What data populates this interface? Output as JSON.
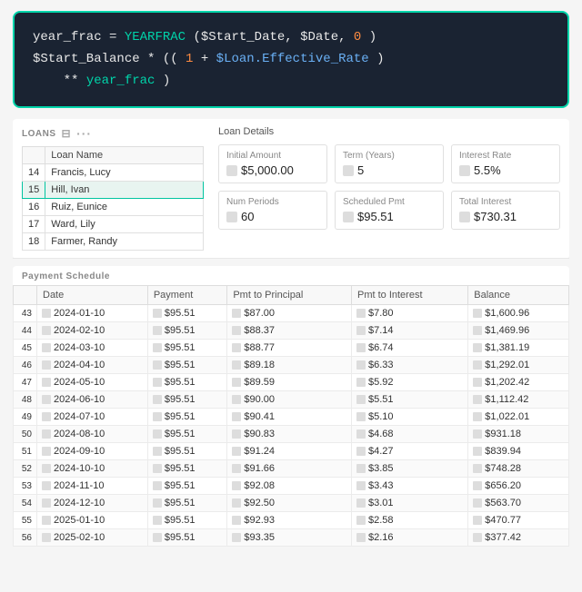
{
  "code": {
    "line1_parts": [
      {
        "text": "year_frac",
        "color": "white"
      },
      {
        "text": " = ",
        "color": "white"
      },
      {
        "text": "YEARFRAC",
        "color": "cyan"
      },
      {
        "text": "($Start_Date, $Date, ",
        "color": "white"
      },
      {
        "text": "0",
        "color": "orange"
      },
      {
        "text": ")",
        "color": "white"
      }
    ],
    "line2_parts": [
      {
        "text": "$Start_Balance",
        "color": "white"
      },
      {
        "text": " * ((",
        "color": "white"
      },
      {
        "text": "1",
        "color": "orange"
      },
      {
        "text": " + ",
        "color": "white"
      },
      {
        "text": "$Loan.Effective_Rate",
        "color": "cyan"
      },
      {
        "text": ")",
        "color": "white"
      }
    ],
    "line3_parts": [
      {
        "text": "** year_frac",
        "color": "cyan"
      },
      {
        "text": ")",
        "color": "white"
      }
    ]
  },
  "loans_section": {
    "header": "LOANS",
    "columns": [
      "Loan Name"
    ],
    "rows": [
      {
        "num": "14",
        "name": "Francis, Lucy",
        "selected": false
      },
      {
        "num": "15",
        "name": "Hill, Ivan",
        "selected": true
      },
      {
        "num": "16",
        "name": "Ruiz, Eunice",
        "selected": false
      },
      {
        "num": "17",
        "name": "Ward, Lily",
        "selected": false
      },
      {
        "num": "18",
        "name": "Farmer, Randy",
        "selected": false
      }
    ]
  },
  "loan_details": {
    "title": "Loan Details",
    "cards": [
      {
        "label": "Initial Amount",
        "value": "$5,000.00"
      },
      {
        "label": "Term (Years)",
        "value": "5"
      },
      {
        "label": "Interest Rate",
        "value": "5.5%"
      },
      {
        "label": "Num Periods",
        "value": "60"
      },
      {
        "label": "Scheduled Pmt",
        "value": "$95.51"
      },
      {
        "label": "Total Interest",
        "value": "$730.31"
      }
    ]
  },
  "payment_schedule": {
    "title": "Payment Schedule",
    "columns": [
      "",
      "Date",
      "Payment",
      "Pmt to Principal",
      "Pmt to Interest",
      "Balance"
    ],
    "rows": [
      {
        "idx": "43",
        "date": "2024-01-10",
        "payment": "$95.51",
        "principal": "$87.00",
        "interest": "$7.80",
        "balance": "$1,600.96",
        "partial": true
      },
      {
        "idx": "44",
        "date": "2024-02-10",
        "payment": "$95.51",
        "principal": "$88.37",
        "interest": "$7.14",
        "balance": "$1,469.96"
      },
      {
        "idx": "45",
        "date": "2024-03-10",
        "payment": "$95.51",
        "principal": "$88.77",
        "interest": "$6.74",
        "balance": "$1,381.19"
      },
      {
        "idx": "46",
        "date": "2024-04-10",
        "payment": "$95.51",
        "principal": "$89.18",
        "interest": "$6.33",
        "balance": "$1,292.01"
      },
      {
        "idx": "47",
        "date": "2024-05-10",
        "payment": "$95.51",
        "principal": "$89.59",
        "interest": "$5.92",
        "balance": "$1,202.42"
      },
      {
        "idx": "48",
        "date": "2024-06-10",
        "payment": "$95.51",
        "principal": "$90.00",
        "interest": "$5.51",
        "balance": "$1,112.42"
      },
      {
        "idx": "49",
        "date": "2024-07-10",
        "payment": "$95.51",
        "principal": "$90.41",
        "interest": "$5.10",
        "balance": "$1,022.01"
      },
      {
        "idx": "50",
        "date": "2024-08-10",
        "payment": "$95.51",
        "principal": "$90.83",
        "interest": "$4.68",
        "balance": "$931.18"
      },
      {
        "idx": "51",
        "date": "2024-09-10",
        "payment": "$95.51",
        "principal": "$91.24",
        "interest": "$4.27",
        "balance": "$839.94"
      },
      {
        "idx": "52",
        "date": "2024-10-10",
        "payment": "$95.51",
        "principal": "$91.66",
        "interest": "$3.85",
        "balance": "$748.28"
      },
      {
        "idx": "53",
        "date": "2024-11-10",
        "payment": "$95.51",
        "principal": "$92.08",
        "interest": "$3.43",
        "balance": "$656.20"
      },
      {
        "idx": "54",
        "date": "2024-12-10",
        "payment": "$95.51",
        "principal": "$92.50",
        "interest": "$3.01",
        "balance": "$563.70"
      },
      {
        "idx": "55",
        "date": "2025-01-10",
        "payment": "$95.51",
        "principal": "$92.93",
        "interest": "$2.58",
        "balance": "$470.77"
      },
      {
        "idx": "56",
        "date": "2025-02-10",
        "payment": "$95.51",
        "principal": "$93.35",
        "interest": "$2.16",
        "balance": "$377.42"
      }
    ]
  }
}
